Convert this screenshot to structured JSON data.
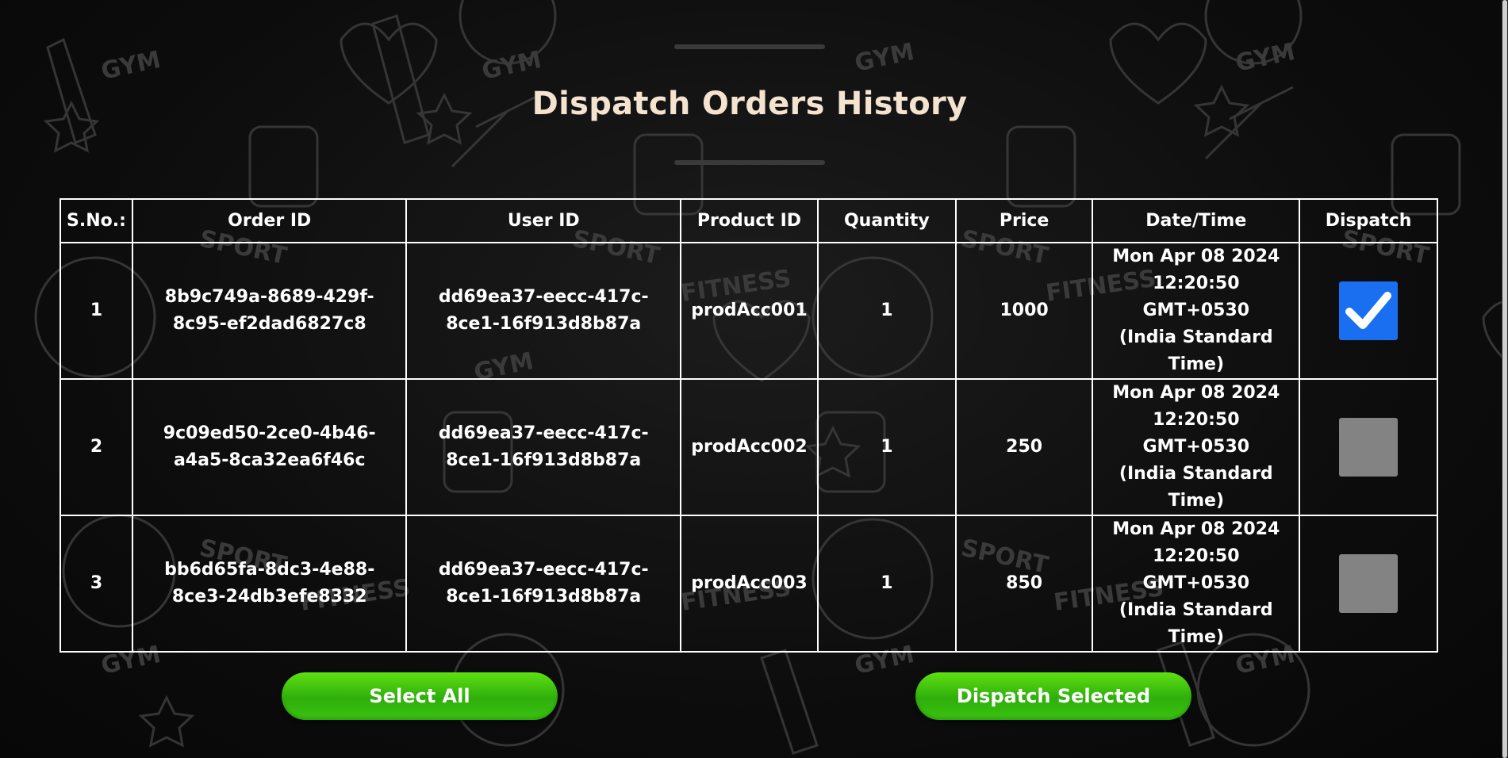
{
  "page": {
    "title": "Dispatch Orders History"
  },
  "table": {
    "headers": {
      "sno": "S.No.:",
      "order_id": "Order ID",
      "user_id": "User ID",
      "product_id": "Product ID",
      "quantity": "Quantity",
      "price": "Price",
      "datetime": "Date/Time",
      "dispatch": "Dispatch"
    },
    "rows": [
      {
        "sno": "1",
        "order_id_1": "8b9c749a-8689-429f-",
        "order_id_2": "8c95-ef2dad6827c8",
        "user_id_1": "dd69ea37-eecc-417c-",
        "user_id_2": "8ce1-16f913d8b87a",
        "product_id": "prodAcc001",
        "quantity": "1",
        "price": "1000",
        "dt_1": "Mon Apr 08 2024",
        "dt_2": "12:20:50 GMT+0530",
        "dt_3": "(India Standard",
        "dt_4": "Time)",
        "dispatch_checked": true
      },
      {
        "sno": "2",
        "order_id_1": "9c09ed50-2ce0-4b46-",
        "order_id_2": "a4a5-8ca32ea6f46c",
        "user_id_1": "dd69ea37-eecc-417c-",
        "user_id_2": "8ce1-16f913d8b87a",
        "product_id": "prodAcc002",
        "quantity": "1",
        "price": "250",
        "dt_1": "Mon Apr 08 2024",
        "dt_2": "12:20:50 GMT+0530",
        "dt_3": "(India Standard",
        "dt_4": "Time)",
        "dispatch_checked": false
      },
      {
        "sno": "3",
        "order_id_1": "bb6d65fa-8dc3-4e88-",
        "order_id_2": "8ce3-24db3efe8332",
        "user_id_1": "dd69ea37-eecc-417c-",
        "user_id_2": "8ce1-16f913d8b87a",
        "product_id": "prodAcc003",
        "quantity": "1",
        "price": "850",
        "dt_1": "Mon Apr 08 2024",
        "dt_2": "12:20:50 GMT+0530",
        "dt_3": "(India Standard",
        "dt_4": "Time)",
        "dispatch_checked": false
      }
    ]
  },
  "buttons": {
    "select_all": "Select All",
    "dispatch_selected": "Dispatch Selected"
  },
  "background_doodles": {
    "word_gym": "GYM",
    "word_sport": "SPORT",
    "word_fitness": "FITNESS"
  },
  "colors": {
    "title": "#f3e3cf",
    "checkbox_checked": "#1a6ff0",
    "checkbox_unchecked": "#8a8a8a",
    "button_green": "#3fc10e"
  },
  "icons": {
    "checkmark": "check-icon"
  }
}
